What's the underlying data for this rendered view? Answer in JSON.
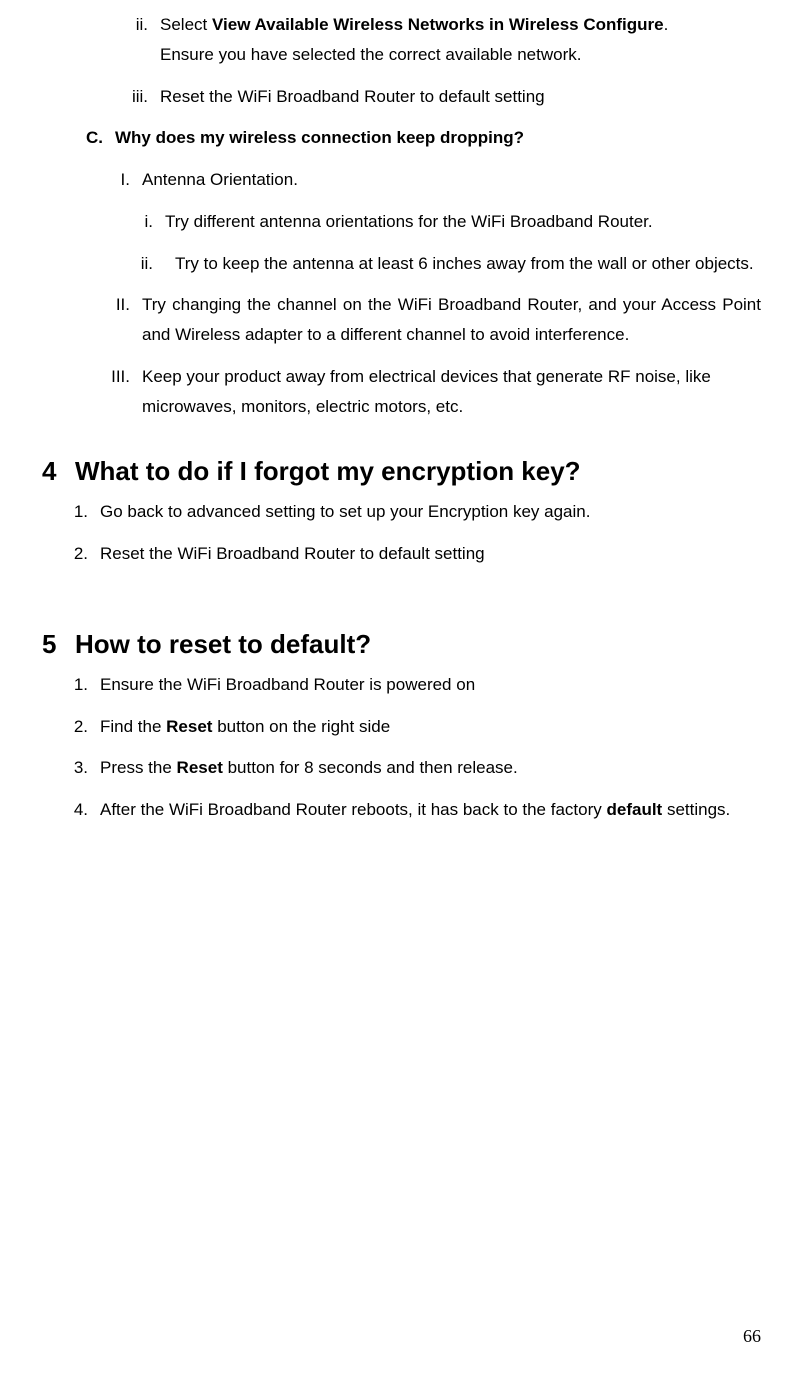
{
  "topItems": {
    "ii": {
      "marker": "ii.",
      "line1_prefix": "Select ",
      "line1_bold": "View Available Wireless Networks in Wireless Configure",
      "line1_suffix": ".",
      "line2": "Ensure you have selected the correct available network."
    },
    "iii": {
      "marker": "iii.",
      "text": "Reset the WiFi Broadband Router to default setting"
    }
  },
  "sectionC": {
    "marker": "C.",
    "title": "Why does my wireless connection keep dropping?",
    "I": {
      "marker": "I.",
      "text": "Antenna Orientation.",
      "i": {
        "marker": "i.",
        "text": "Try different antenna orientations for the WiFi Broadband Router."
      },
      "ii": {
        "marker": "ii.",
        "text": "Try to keep the antenna at least 6 inches away from the wall or other objects."
      }
    },
    "II": {
      "marker": "II.",
      "text": "Try changing the channel on the WiFi Broadband Router, and your Access Point and Wireless adapter to a different channel to avoid interference."
    },
    "III": {
      "marker": "III.",
      "text": "Keep your product away from electrical devices that generate RF noise, like microwaves, monitors, electric motors, etc."
    }
  },
  "section4": {
    "marker": "4",
    "title": "What to do if I forgot my encryption key?",
    "items": {
      "1": {
        "marker": "1.",
        "text": "Go back to advanced setting to set up your Encryption key again."
      },
      "2": {
        "marker": "2.",
        "text": "Reset the WiFi Broadband Router to default setting"
      }
    }
  },
  "section5": {
    "marker": "5",
    "title": "How to reset to default?",
    "items": {
      "1": {
        "marker": "1.",
        "text": "Ensure the WiFi Broadband Router is powered on"
      },
      "2": {
        "marker": "2.",
        "prefix": "Find the ",
        "bold": "Reset",
        "suffix": " button on the right side"
      },
      "3": {
        "marker": "3.",
        "prefix": "Press the ",
        "bold": "Reset",
        "suffix": " button for 8 seconds and then release."
      },
      "4": {
        "marker": "4.",
        "prefix": "After the WiFi Broadband Router reboots, it has back to the factory ",
        "bold": "default",
        "suffix": " settings."
      }
    }
  },
  "pageNumber": "66"
}
